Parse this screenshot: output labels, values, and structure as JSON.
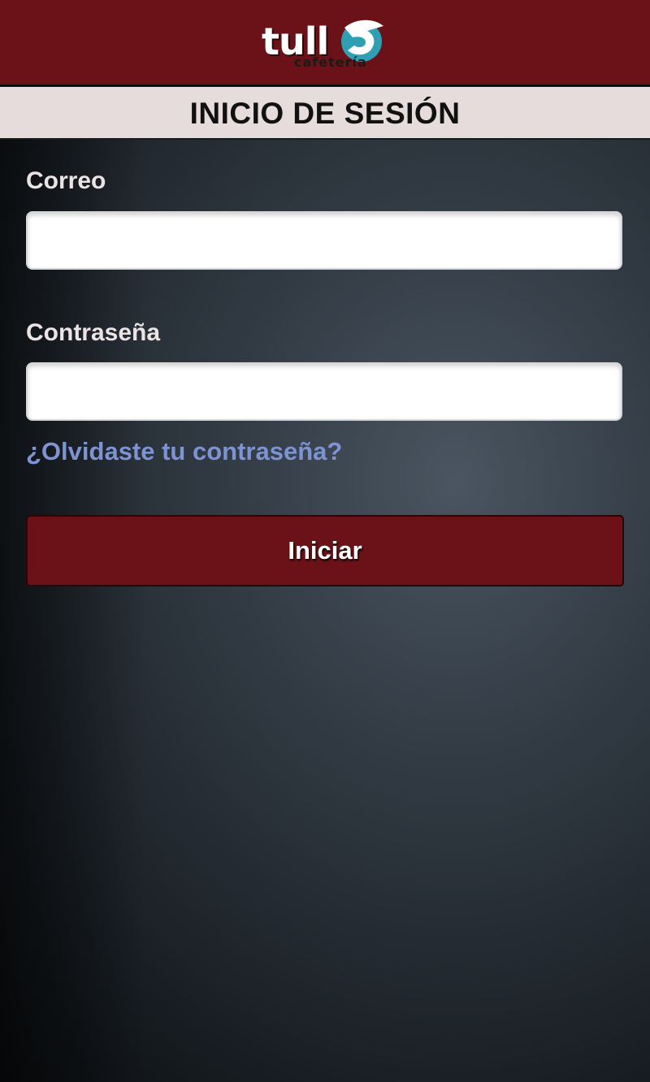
{
  "header": {
    "logo": {
      "word_main": "tull",
      "word_accent": "",
      "subtitle": "cafetería"
    }
  },
  "page": {
    "title": "INICIO DE SESIÓN"
  },
  "form": {
    "email": {
      "label": "Correo",
      "value": "",
      "placeholder": ""
    },
    "password": {
      "label": "Contraseña",
      "value": "",
      "placeholder": ""
    },
    "forgot_link": "¿Olvidaste tu contraseña?",
    "submit_label": "Iniciar"
  },
  "colors": {
    "brand": "#6a1217",
    "title_bar": "#e6dcdc",
    "link": "#7d93d2",
    "logo_mark": "#2f9fb3"
  },
  "icons": {
    "logo_mark": "logo-swirl-icon"
  }
}
